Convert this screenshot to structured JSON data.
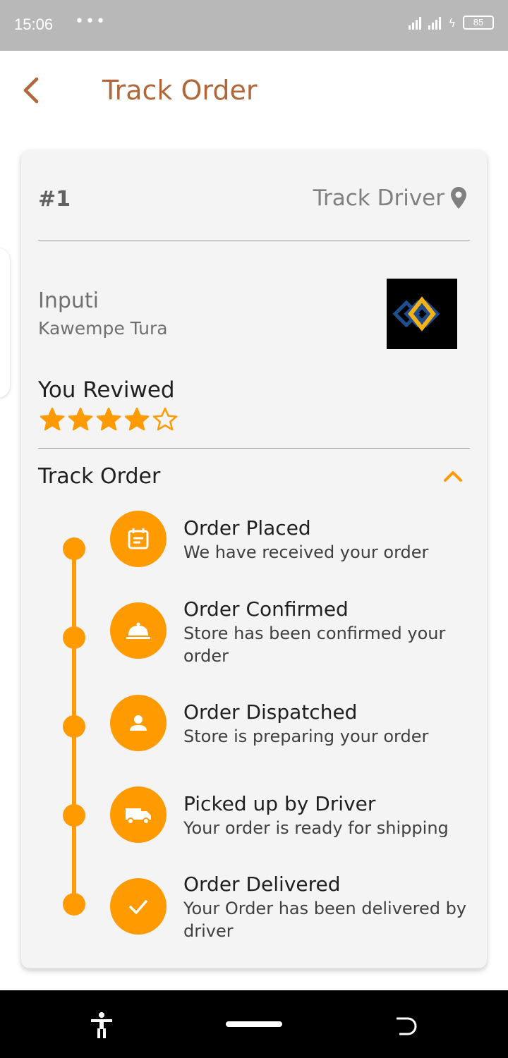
{
  "status_bar": {
    "time": "15:06",
    "dots": "•••",
    "battery": "85",
    "charging_symbol": "ϟ"
  },
  "app_bar": {
    "title": "Track Order",
    "accent_color": "#b0683a"
  },
  "order": {
    "number": "#1",
    "track_driver_label": "Track Driver",
    "store_name": "Inputi",
    "store_address": "Kawempe Tura",
    "review_label": "You Reviwed",
    "rating": 4,
    "rating_max": 5
  },
  "tracking": {
    "title": "Track Order",
    "accent_color": "#ff9a00",
    "steps": [
      {
        "title": "Order Placed",
        "description": "We have received your order",
        "icon": "calendar-icon"
      },
      {
        "title": "Order Confirmed",
        "description": "Store has been confirmed your order",
        "icon": "cloche-icon"
      },
      {
        "title": "Order Dispatched",
        "description": "Store is preparing your order",
        "icon": "person-icon"
      },
      {
        "title": "Picked up by Driver",
        "description": "Your order is ready for shipping",
        "icon": "truck-icon"
      },
      {
        "title": "Order Delivered",
        "description": "Your Order has been delivered by driver",
        "icon": "checkmark-icon"
      }
    ]
  },
  "nav_bar": {
    "icons": [
      "accessibility-icon",
      "home-pill",
      "back-gesture-icon"
    ]
  }
}
